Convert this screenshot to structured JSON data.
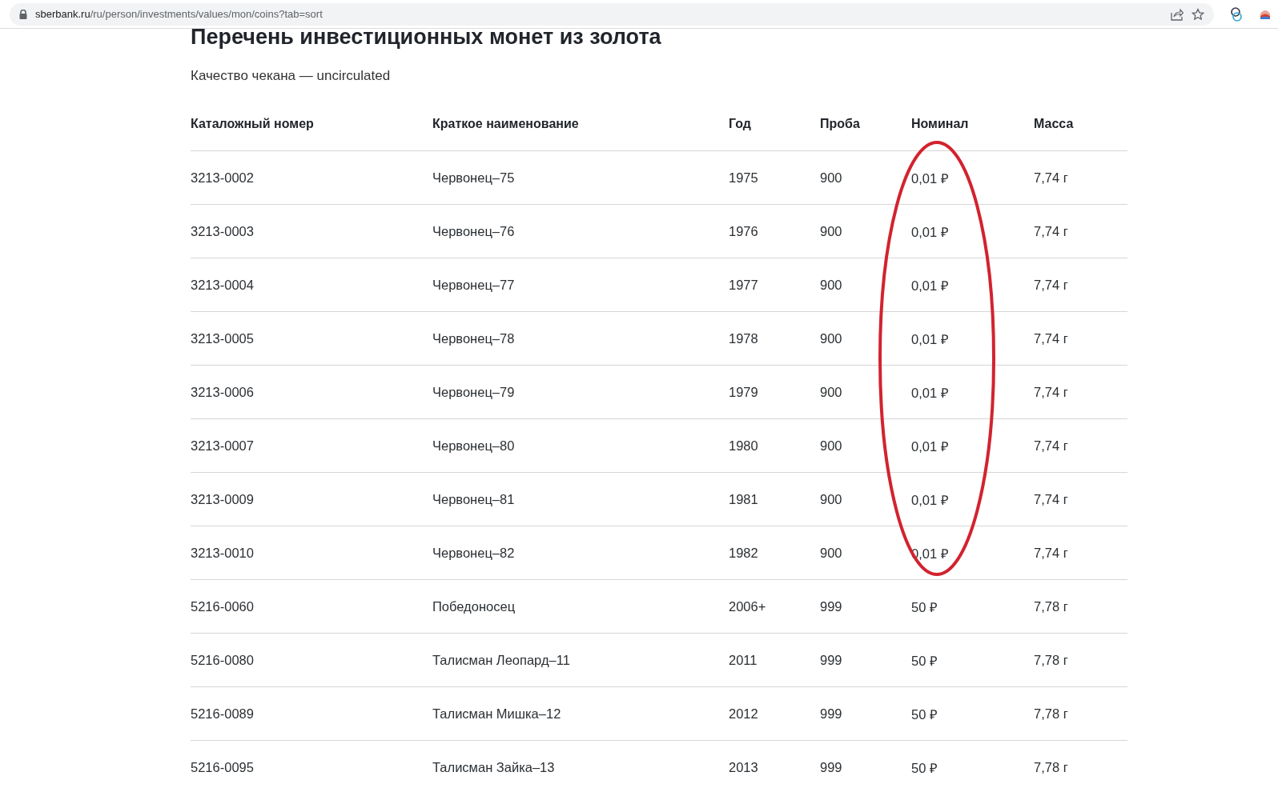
{
  "browser": {
    "url_domain": "sberbank.ru",
    "url_path": "/ru/person/investments/values/mon/coins?tab=sort"
  },
  "heading": "Перечень инвестиционных монет из золота",
  "subtitle": "Качество чекана — uncirculated",
  "table": {
    "columns": [
      "Каталожный номер",
      "Краткое наименование",
      "Год",
      "Проба",
      "Номинал",
      "Масса"
    ],
    "rows": [
      [
        "3213-0002",
        "Червонец–75",
        "1975",
        "900",
        "0,01 ₽",
        "7,74 г"
      ],
      [
        "3213-0003",
        "Червонец–76",
        "1976",
        "900",
        "0,01 ₽",
        "7,74 г"
      ],
      [
        "3213-0004",
        "Червонец–77",
        "1977",
        "900",
        "0,01 ₽",
        "7,74 г"
      ],
      [
        "3213-0005",
        "Червонец–78",
        "1978",
        "900",
        "0,01 ₽",
        "7,74 г"
      ],
      [
        "3213-0006",
        "Червонец–79",
        "1979",
        "900",
        "0,01 ₽",
        "7,74 г"
      ],
      [
        "3213-0007",
        "Червонец–80",
        "1980",
        "900",
        "0,01 ₽",
        "7,74 г"
      ],
      [
        "3213-0009",
        "Червонец–81",
        "1981",
        "900",
        "0,01 ₽",
        "7,74 г"
      ],
      [
        "3213-0010",
        "Червонец–82",
        "1982",
        "900",
        "0,01 ₽",
        "7,74 г"
      ],
      [
        "5216-0060",
        "Победоносец",
        "2006+",
        "999",
        "50 ₽",
        "7,78 г"
      ],
      [
        "5216-0080",
        "Талисман Леопард–11",
        "2011",
        "999",
        "50 ₽",
        "7,78 г"
      ],
      [
        "5216-0089",
        "Талисман Мишка–12",
        "2012",
        "999",
        "50 ₽",
        "7,78 г"
      ],
      [
        "5216-0095",
        "Талисман Зайка–13",
        "2013",
        "999",
        "50 ₽",
        "7,78 г"
      ]
    ]
  },
  "annotation": {
    "kind": "ellipse"
  }
}
